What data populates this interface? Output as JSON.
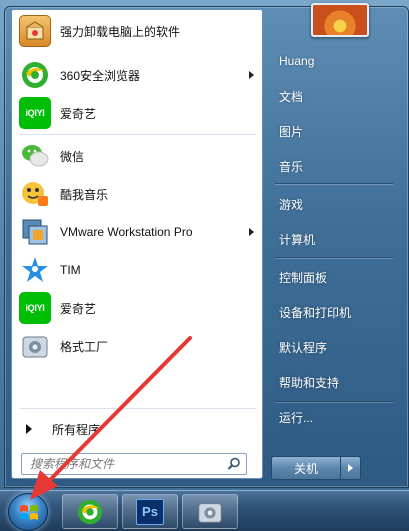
{
  "programs": [
    {
      "label": "强力卸载电脑上的软件",
      "icon": "uninstall-box-icon",
      "has_submenu": false
    },
    {
      "label": "360安全浏览器",
      "icon": "360-browser-icon",
      "has_submenu": true
    },
    {
      "label": "爱奇艺",
      "icon": "iqiyi-icon",
      "icon_text": "iQIYI",
      "has_submenu": false
    },
    {
      "label": "微信",
      "icon": "wechat-icon",
      "has_submenu": false
    },
    {
      "label": "酷我音乐",
      "icon": "kuwo-music-icon",
      "has_submenu": false
    },
    {
      "label": "VMware Workstation Pro",
      "icon": "vmware-icon",
      "has_submenu": true
    },
    {
      "label": "TIM",
      "icon": "tim-icon",
      "has_submenu": false
    },
    {
      "label": "爱奇艺",
      "icon": "iqiyi-icon",
      "icon_text": "iQIYI",
      "has_submenu": false
    },
    {
      "label": "格式工厂",
      "icon": "format-factory-icon",
      "has_submenu": false
    }
  ],
  "all_programs_label": "所有程序",
  "search": {
    "placeholder": "搜索程序和文件",
    "value": ""
  },
  "right_items": [
    {
      "label": "Huang"
    },
    {
      "label": "文档"
    },
    {
      "label": "图片"
    },
    {
      "label": "音乐"
    },
    {
      "label": "游戏"
    },
    {
      "label": "计算机"
    },
    {
      "label": "控制面板"
    },
    {
      "label": "设备和打印机"
    },
    {
      "label": "默认程序"
    },
    {
      "label": "帮助和支持"
    },
    {
      "label": "运行..."
    }
  ],
  "shutdown_label": "关机",
  "taskbar": {
    "pinned": [
      {
        "icon": "360-browser-icon"
      },
      {
        "icon": "photoshop-icon",
        "text": "Ps"
      },
      {
        "icon": "format-factory-icon"
      }
    ]
  },
  "colors": {
    "accent": "#e53935",
    "iqiyi_green": "#00be06",
    "ps_blue": "#0a2f6b"
  }
}
